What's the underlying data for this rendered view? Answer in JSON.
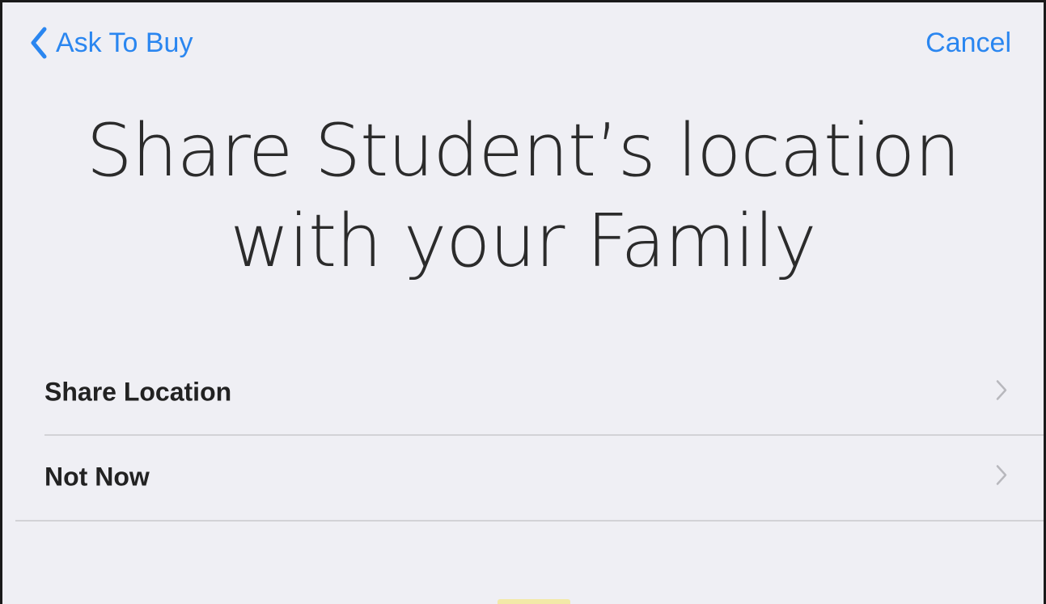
{
  "nav": {
    "back_label": "Ask To Buy",
    "cancel_label": "Cancel"
  },
  "title": {
    "line1": "Share Student’s location",
    "line2": "with your Family"
  },
  "options": [
    {
      "label": "Share Location"
    },
    {
      "label": "Not Now"
    }
  ],
  "colors": {
    "accent": "#2a86f0",
    "background": "#efeff4",
    "separator": "#d2d2d6",
    "chevron": "#b8b8bd"
  },
  "icons": {
    "back": "chevron-left-icon",
    "row": "chevron-right-icon"
  }
}
